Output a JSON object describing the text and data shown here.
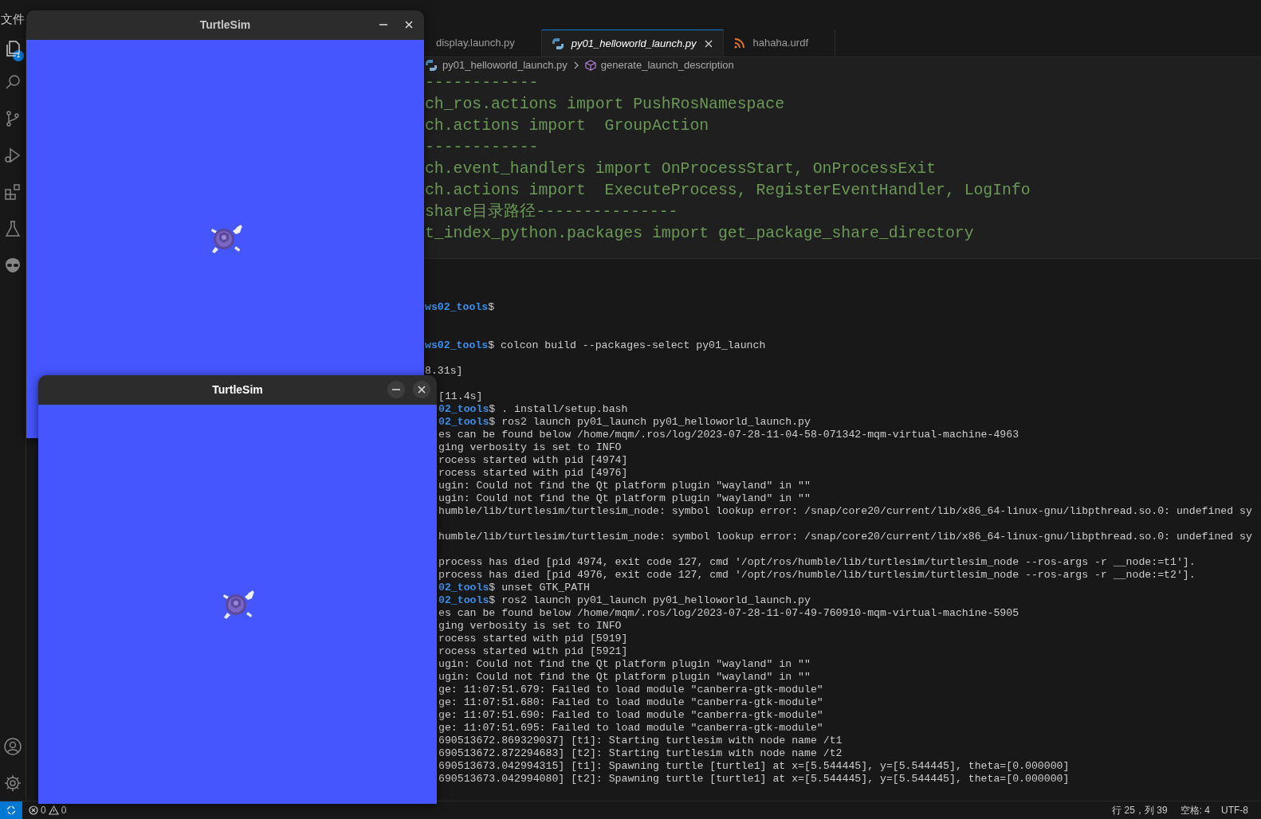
{
  "menu_bar": {
    "label": "文件"
  },
  "activity_bar": {
    "badge": "1"
  },
  "tabs": [
    {
      "label": "display.launch.py",
      "selected": false
    },
    {
      "label": "py01_helloworld_launch.py",
      "selected": true,
      "kind": "python"
    },
    {
      "label": "hahaha.urdf",
      "selected": false,
      "kind": "rss"
    }
  ],
  "breadcrumb": [
    "py01_helloworld_launch.py",
    "generate_launch_description"
  ],
  "code_lines": [
    "------------",
    "ch_ros.actions import PushRosNamespace",
    "ch.actions import  GroupAction",
    "------------",
    "ch.event_handlers import OnProcessStart, OnProcessExit",
    "ch.actions import  ExecuteProcess, RegisterEventHandler, LogInfo",
    "share目录路径---------------",
    "t_index_python.packages import get_package_share_directory"
  ],
  "terminal": {
    "upper_lines": [
      {
        "kind": "prompt",
        "prompt": "ws02_tools",
        "text": "$"
      },
      {
        "kind": "blank"
      },
      {
        "kind": "blank"
      },
      {
        "kind": "prompt",
        "prompt": "ws02_tools",
        "text": "$ colcon build --packages-select py01_launch"
      },
      {
        "kind": "blank"
      },
      {
        "kind": "output",
        "text": "8.31s]"
      }
    ],
    "lower_lines": [
      {
        "kind": "blank"
      },
      {
        "kind": "output",
        "text": "[11.4s]"
      },
      {
        "kind": "prompt",
        "prompt": "02_tools",
        "text": "$ . install/setup.bash"
      },
      {
        "kind": "prompt",
        "prompt": "02_tools",
        "text": "$ ros2 launch py01_launch py01_helloworld_launch.py"
      },
      {
        "kind": "output",
        "text": "es can be found below /home/mqm/.ros/log/2023-07-28-11-04-58-071342-mqm-virtual-machine-4963"
      },
      {
        "kind": "output",
        "text": "ging verbosity is set to INFO"
      },
      {
        "kind": "output",
        "text": "rocess started with pid [4974]"
      },
      {
        "kind": "output",
        "text": "rocess started with pid [4976]"
      },
      {
        "kind": "output",
        "text": "ugin: Could not find the Qt platform plugin \"wayland\" in \"\""
      },
      {
        "kind": "output",
        "text": "ugin: Could not find the Qt platform plugin \"wayland\" in \"\""
      },
      {
        "kind": "output",
        "text": "humble/lib/turtlesim/turtlesim_node: symbol lookup error: /snap/core20/current/lib/x86_64-linux-gnu/libpthread.so.0: undefined sy"
      },
      {
        "kind": "blank"
      },
      {
        "kind": "output",
        "text": "humble/lib/turtlesim/turtlesim_node: symbol lookup error: /snap/core20/current/lib/x86_64-linux-gnu/libpthread.so.0: undefined sy"
      },
      {
        "kind": "blank"
      },
      {
        "kind": "output",
        "text": "process has died [pid 4974, exit code 127, cmd '/opt/ros/humble/lib/turtlesim/turtlesim_node --ros-args -r __node:=t1']."
      },
      {
        "kind": "output",
        "text": "process has died [pid 4976, exit code 127, cmd '/opt/ros/humble/lib/turtlesim/turtlesim_node --ros-args -r __node:=t2']."
      },
      {
        "kind": "prompt",
        "prompt": "02_tools",
        "text": "$ unset GTK_PATH"
      },
      {
        "kind": "prompt",
        "prompt": "02_tools",
        "text": "$ ros2 launch py01_launch py01_helloworld_launch.py"
      },
      {
        "kind": "output",
        "text": "es can be found below /home/mqm/.ros/log/2023-07-28-11-07-49-760910-mqm-virtual-machine-5905"
      },
      {
        "kind": "output",
        "text": "ging verbosity is set to INFO"
      },
      {
        "kind": "output",
        "text": "rocess started with pid [5919]"
      },
      {
        "kind": "output",
        "text": "rocess started with pid [5921]"
      },
      {
        "kind": "output",
        "text": "ugin: Could not find the Qt platform plugin \"wayland\" in \"\""
      },
      {
        "kind": "output",
        "text": "ugin: Could not find the Qt platform plugin \"wayland\" in \"\""
      },
      {
        "kind": "output",
        "text": "ge: 11:07:51.679: Failed to load module \"canberra-gtk-module\""
      },
      {
        "kind": "output",
        "text": "ge: 11:07:51.680: Failed to load module \"canberra-gtk-module\""
      },
      {
        "kind": "output",
        "text": "ge: 11:07:51.690: Failed to load module \"canberra-gtk-module\""
      },
      {
        "kind": "output",
        "text": "ge: 11:07:51.695: Failed to load module \"canberra-gtk-module\""
      },
      {
        "kind": "output",
        "text": "690513672.869329037] [t1]: Starting turtlesim with node name /t1"
      },
      {
        "kind": "output",
        "text": "690513672.872294683] [t2]: Starting turtlesim with node name /t2"
      },
      {
        "kind": "output",
        "text": "690513673.042994315] [t1]: Spawning turtle [turtle1] at x=[5.544445], y=[5.544445], theta=[0.000000]"
      },
      {
        "kind": "output",
        "text": "690513673.042994080] [t2]: Spawning turtle [turtle1] at x=[5.544445], y=[5.544445], theta=[0.000000]"
      }
    ]
  },
  "status_bar": {
    "errors": "0",
    "warnings": "0",
    "position": "行 25，列 39",
    "indent": "空格: 4",
    "encoding": "UTF-8"
  },
  "windows": [
    {
      "title": "TurtleSim",
      "focused": false
    },
    {
      "title": "TurtleSim",
      "focused": true
    }
  ]
}
